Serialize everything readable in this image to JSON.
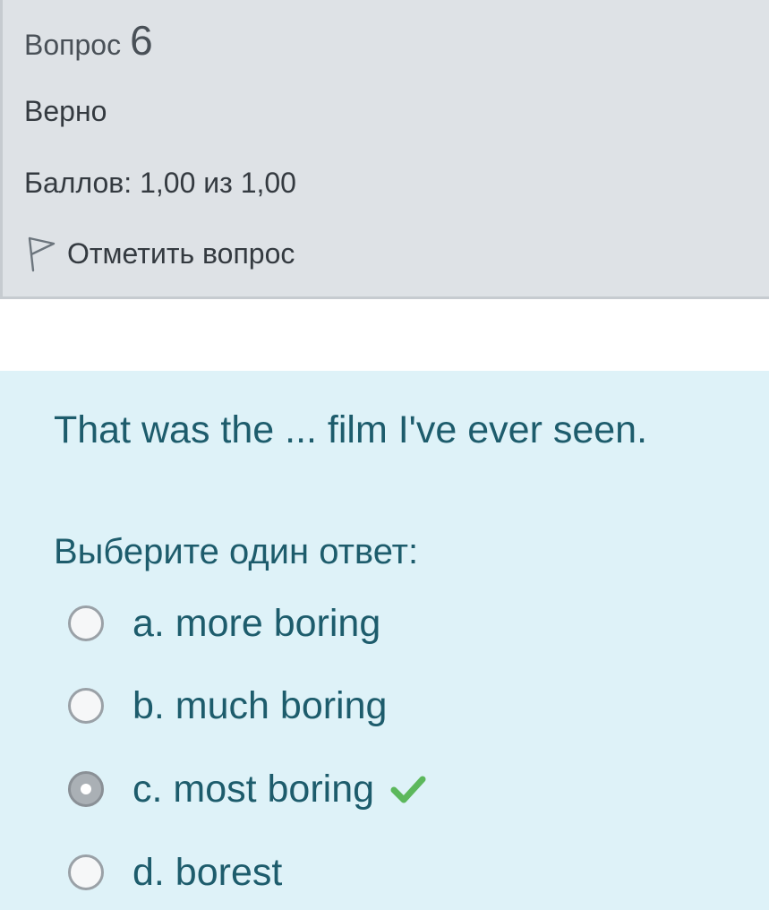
{
  "question_info": {
    "label": "Вопрос",
    "number": "6",
    "state": "Верно",
    "grade": "Баллов: 1,00 из 1,00",
    "flag_label": "Отметить вопрос",
    "flag_icon": "flag-icon"
  },
  "formulation": {
    "question_text": "That was the ... film I've ever seen.",
    "prompt": "Выберите один ответ:",
    "answers": [
      {
        "label": "a. more boring",
        "selected": false
      },
      {
        "label": "b. much boring",
        "selected": false
      },
      {
        "label": "c. most boring",
        "selected": true,
        "feedback_icon": "check-icon"
      },
      {
        "label": "d. borest",
        "selected": false
      }
    ]
  },
  "colors": {
    "info_background": "#dee2e6",
    "formulation_background": "#def2f8",
    "question_text": "#1d5c6c",
    "correct_check": "#5cb85c"
  }
}
